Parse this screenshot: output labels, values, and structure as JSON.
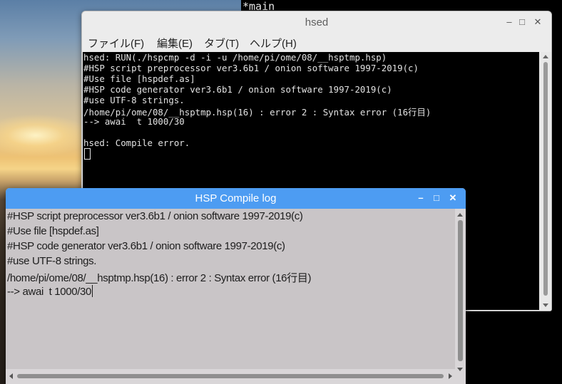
{
  "background_terminal": {
    "text": "*main"
  },
  "hsed": {
    "title": "hsed",
    "controls": {
      "minimize": "–",
      "maximize": "□",
      "close": "✕"
    },
    "menu": [
      {
        "label": "ファイル(F)"
      },
      {
        "label": "編集(E)"
      },
      {
        "label": "タブ(T)"
      },
      {
        "label": "ヘルプ(H)"
      }
    ],
    "terminal_lines": [
      "hsed: RUN(./hspcmp -d -i -u /home/pi/ome/08/__hsptmp.hsp)",
      "#HSP script preprocessor ver3.6b1 / onion software 1997-2019(c)",
      "#Use file [hspdef.as]",
      "#HSP code generator ver3.6b1 / onion software 1997-2019(c)",
      "#use UTF-8 strings.",
      "/home/pi/ome/08/__hsptmp.hsp(16) : error 2 : Syntax error (16行目)",
      "--> awai  t 1000/30",
      "",
      "hsed: Compile error."
    ]
  },
  "compile_log": {
    "title": "HSP Compile log",
    "controls": {
      "minimize": "–",
      "maximize": "□",
      "close": "✕"
    },
    "lines": [
      "#HSP script preprocessor ver3.6b1 / onion software 1997-2019(c)",
      "#Use file [hspdef.as]",
      "#HSP code generator ver3.6b1 / onion software 1997-2019(c)",
      "#use UTF-8 strings.",
      "/home/pi/ome/08/__hsptmp.hsp(16) : error 2 : Syntax error (16行目)",
      "--> awai  t 1000/30"
    ]
  },
  "colors": {
    "log_titlebar": "#4d9cf2",
    "log_body": "#c9c5c7",
    "terminal_bg": "#000000",
    "terminal_fg": "#e2e2e2"
  }
}
